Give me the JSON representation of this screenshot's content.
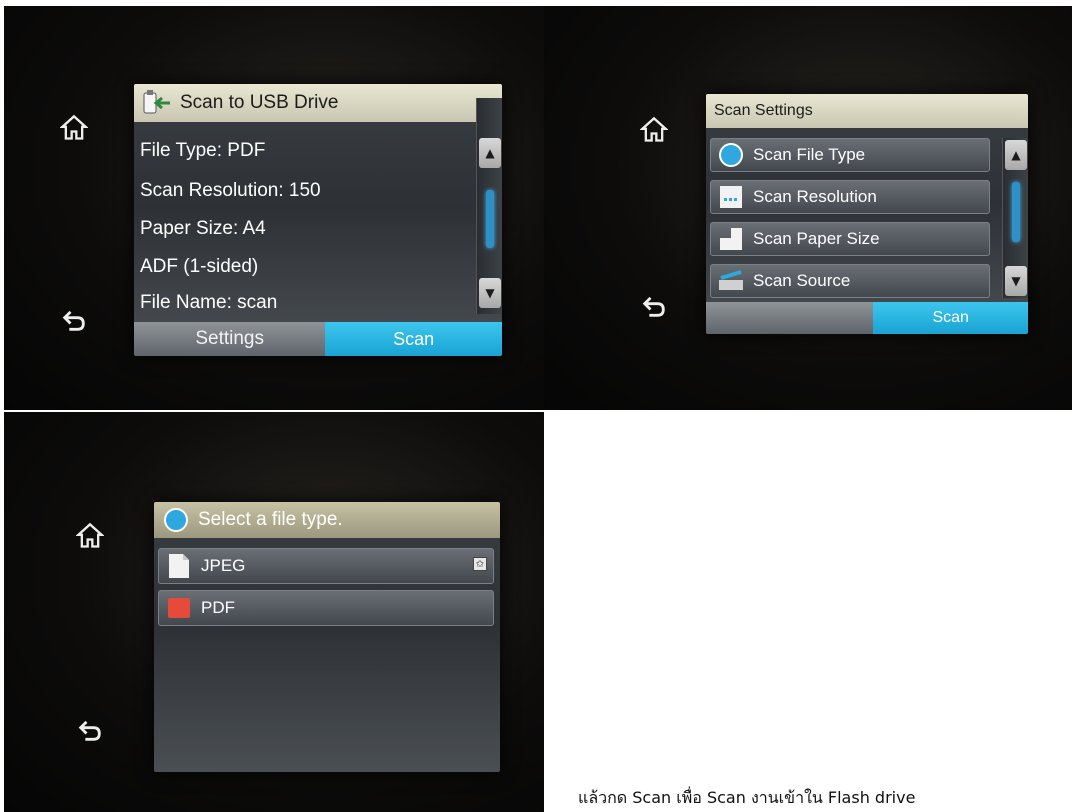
{
  "panel1": {
    "header_title": "Scan to USB Drive",
    "header_icon": "usb-drive-icon",
    "lines": [
      "File Type: PDF",
      "Scan Resolution: 150",
      "Paper Size: A4",
      "ADF (1-sided)",
      "File Name: scan"
    ],
    "settings_label": "Settings",
    "scan_label": "Scan"
  },
  "panel2": {
    "header_title": "Scan Settings",
    "items": [
      {
        "label": "Scan File Type",
        "icon": "file-type-icon"
      },
      {
        "label": "Scan Resolution",
        "icon": "resolution-icon"
      },
      {
        "label": "Scan Paper Size",
        "icon": "paper-size-icon"
      },
      {
        "label": "Scan Source",
        "icon": "scan-source-icon"
      }
    ],
    "scan_label": "Scan"
  },
  "panel3": {
    "header_title": "Select a file type.",
    "items": [
      {
        "label": "JPEG",
        "icon": "jpeg-file-icon"
      },
      {
        "label": "PDF",
        "icon": "pdf-file-icon"
      }
    ],
    "pdf_badge": "PDF"
  },
  "caption": "แล้วกด Scan เพื่อ Scan งานเข้าใน Flash drive",
  "colors": {
    "scan_button": "#1aa3d3",
    "header_bg": "#e0ddc8",
    "scroll_thumb": "#2f8fc7"
  }
}
